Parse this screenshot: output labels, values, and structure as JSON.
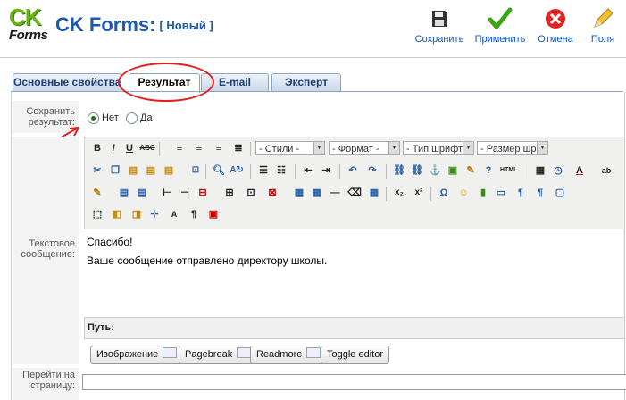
{
  "header": {
    "logo_top": "CK",
    "logo_bottom": "Forms",
    "title": "CK Forms:",
    "subtitle": "[ Новый ]",
    "buttons": [
      {
        "label": "Сохранить",
        "icon": "save-icon"
      },
      {
        "label": "Применить",
        "icon": "apply-checkmark-icon"
      },
      {
        "label": "Отмена",
        "icon": "cancel-icon"
      },
      {
        "label": "Поля",
        "icon": "fields-pencil-icon"
      }
    ]
  },
  "tabs": [
    {
      "label": "Основные свойства",
      "active": false
    },
    {
      "label": "Результат",
      "active": true
    },
    {
      "label": "E-mail",
      "active": false
    },
    {
      "label": "Эксперт",
      "active": false
    }
  ],
  "form": {
    "save_result": {
      "label_line1": "Сохранить",
      "label_line2": "результат:",
      "options": [
        {
          "label": "Нет",
          "selected": true
        },
        {
          "label": "Да",
          "selected": false
        }
      ]
    },
    "text_message": {
      "label_line1": "Текстовое",
      "label_line2": "сообщение:",
      "lines": [
        "Спасибо!",
        "Ваше сообщение отправлено директору школы."
      ]
    },
    "goto_page": {
      "label_line1": "Перейти на",
      "label_line2": "страницу:",
      "value": ""
    }
  },
  "editor": {
    "dropdowns": [
      "- Стили -",
      "- Формат -",
      "- Тип шрифта -",
      "- Размер шриф"
    ],
    "path_label": "Путь:",
    "format_buttons": {
      "bold": "B",
      "italic": "I",
      "underline": "U",
      "strike": "ABC"
    }
  },
  "bottom_buttons": [
    {
      "label": "Изображение"
    },
    {
      "label": "Pagebreak"
    },
    {
      "label": "Readmore"
    },
    {
      "label": "Toggle editor"
    }
  ],
  "colors": {
    "accent": "#1d5aa8",
    "annotation": "#e02020",
    "logo_green": "#69b414"
  }
}
